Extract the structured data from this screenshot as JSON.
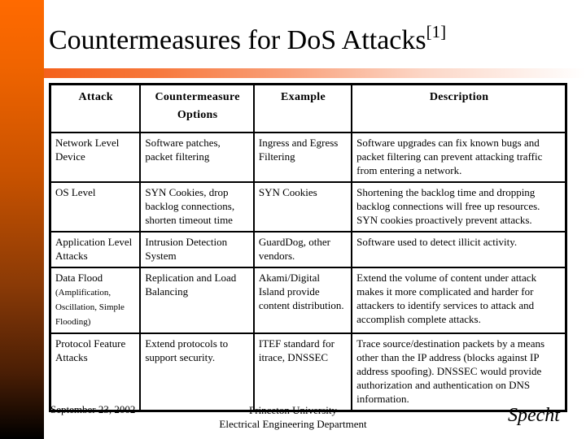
{
  "slide": {
    "title": "Countermeasures for DoS Attacks",
    "title_ref": "[1]",
    "colors": {
      "side_bar_top": "#ff6a00",
      "side_bar_bottom": "#000000",
      "title_rule_start": "#f4611c",
      "title_rule_end": "#ffffff"
    }
  },
  "table": {
    "headers": [
      "Attack",
      "Countermeasure Options",
      "Example",
      "Description"
    ],
    "rows": [
      {
        "attack": "Network Level Device",
        "attack_note": "",
        "countermeasure": "Software patches, packet filtering",
        "example": "Ingress and Egress Filtering",
        "description": "Software upgrades can fix known bugs and packet filtering can prevent attacking traffic from entering a network."
      },
      {
        "attack": "OS Level",
        "attack_note": "",
        "countermeasure": "SYN Cookies, drop backlog connections, shorten timeout time",
        "example": "SYN Cookies",
        "description": "Shortening the backlog time and dropping backlog connections will free up resources. SYN cookies proactively prevent attacks."
      },
      {
        "attack": "Application Level Attacks",
        "attack_note": "",
        "countermeasure": "Intrusion Detection System",
        "example": "GuardDog, other vendors.",
        "description": "Software used to detect illicit activity."
      },
      {
        "attack": "Data Flood",
        "attack_note": "(Amplification, Oscillation, Simple Flooding)",
        "countermeasure": "Replication and Load Balancing",
        "example": "Akami/Digital Island provide content distribution.",
        "description": "Extend the volume of content under attack makes it more complicated and harder for attackers to identify services to attack and accomplish complete attacks."
      },
      {
        "attack": "Protocol Feature Attacks",
        "attack_note": "",
        "countermeasure": "Extend protocols to support security.",
        "example": "ITEF standard for itrace, DNSSEC",
        "description": "Trace source/destination packets by a means other than the IP address (blocks against IP address spoofing).  DNSSEC would provide authorization and authentication on DNS information."
      }
    ]
  },
  "footer": {
    "date": "September 23, 2002",
    "org_line1": "Princeton University",
    "org_line2": "Electrical Engineering Department",
    "author": "Specht"
  }
}
